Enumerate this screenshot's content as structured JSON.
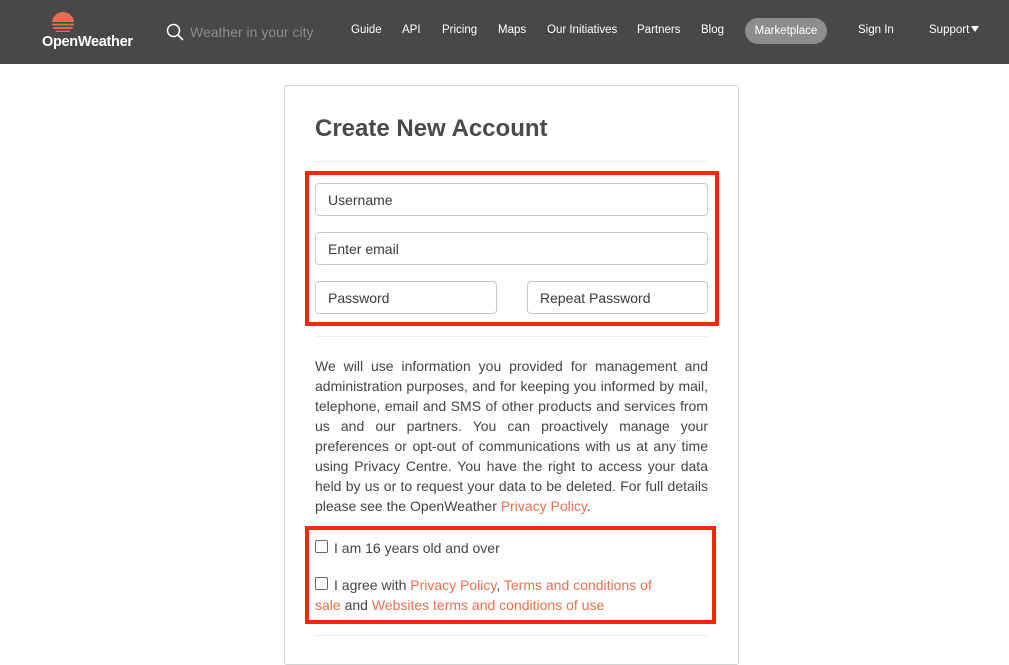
{
  "brand": {
    "name": "OpenWeather",
    "accent": "#e96e50",
    "navbar_bg": "#48484a"
  },
  "search": {
    "placeholder": "Weather in your city"
  },
  "nav": {
    "guide": "Guide",
    "api": "API",
    "pricing": "Pricing",
    "maps": "Maps",
    "initiatives": "Our Initiatives",
    "partners": "Partners",
    "blog": "Blog",
    "marketplace": "Marketplace",
    "signin": "Sign In",
    "support": "Support"
  },
  "form": {
    "title": "Create New Account",
    "username_placeholder": "Username",
    "email_placeholder": "Enter email",
    "password_placeholder": "Password",
    "repeat_password_placeholder": "Repeat Password"
  },
  "info": {
    "text": "We will use information you provided for management and administration purposes, and for keeping you informed by mail, telephone, email and SMS of other products and services from us and our partners. You can proactively manage your preferences or opt-out of communications with us at any time using Privacy Centre. You have the right to access your data held by us or to request your data to be deleted. For full details please see the OpenWeather ",
    "privacy_link": "Privacy Policy",
    "end": "."
  },
  "checkboxes": {
    "age_label": "I am 16 years old and over",
    "agree_prefix": "I agree with ",
    "privacy_link": "Privacy Policy",
    "comma": ", ",
    "terms_link": "Terms and conditions of sale",
    "and": " and ",
    "website_terms_link": "Websites terms and conditions of use"
  },
  "colors": {
    "highlight": "#f4290c"
  }
}
